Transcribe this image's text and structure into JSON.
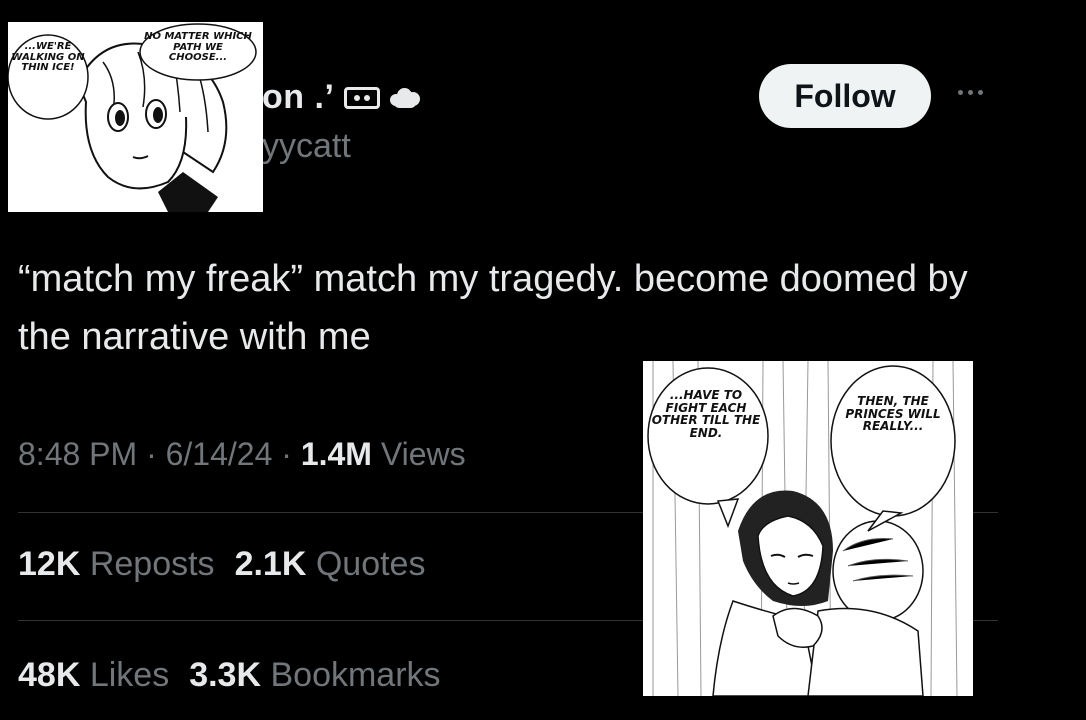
{
  "profile": {
    "display_name_visible": "on .",
    "display_name_mark": "’",
    "handle_visible": "yycatt",
    "cassette_icon": "cassette-icon",
    "cloud_icon": "cloud-icon"
  },
  "follow_button": {
    "label": "Follow"
  },
  "more_icon": "more-options-icon",
  "tweet": {
    "text": "“match my freak” match my tragedy. become doomed by the narrative with me"
  },
  "meta": {
    "time": "8:48 PM",
    "sep1": " · ",
    "date": "6/14/24",
    "sep2": " · ",
    "views_count": "1.4M",
    "views_label": " Views"
  },
  "stats": {
    "reposts_count": "12K",
    "reposts_label": " Reposts",
    "quotes_count": "2.1K",
    "quotes_label": " Quotes",
    "likes_count": "48K",
    "likes_label": " Likes",
    "bookmarks_count": "3.3K",
    "bookmarks_label": " Bookmarks"
  },
  "manga_top": {
    "bubble_left": "...WE'RE WALKING ON THIN ICE!",
    "bubble_right": "NO MATTER WHICH PATH WE CHOOSE..."
  },
  "manga_bottom": {
    "bubble_left": "...HAVE TO FIGHT EACH OTHER TILL THE END.",
    "bubble_right": "THEN, THE PRINCES WILL REALLY..."
  },
  "colors": {
    "background": "#000000",
    "text_primary": "#e7e9ea",
    "text_secondary": "#71767b",
    "follow_bg": "#eff3f4",
    "divider": "#2f3336"
  }
}
